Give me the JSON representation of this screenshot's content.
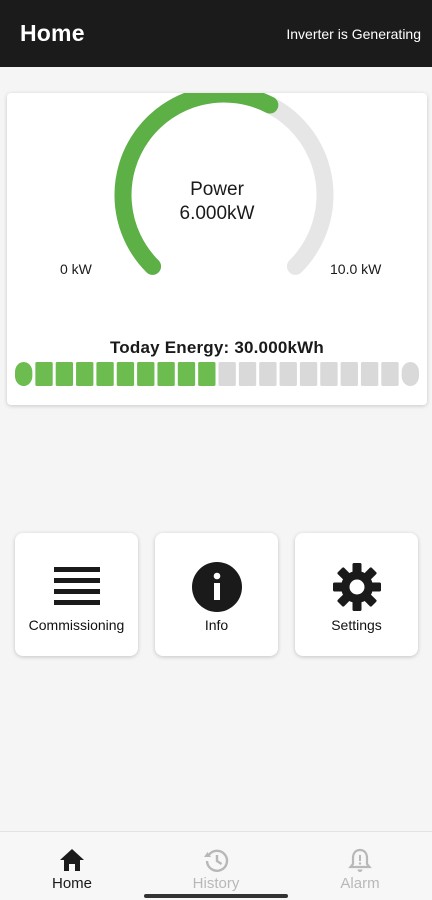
{
  "appbar": {
    "title": "Home",
    "status": "Inverter is Generating"
  },
  "gauge": {
    "label": "Power",
    "value": "6.000kW",
    "min_label": "0 kW",
    "max_label": "10.0 kW",
    "fraction": 0.6,
    "fill_color": "#5cb046",
    "track_color": "#e6e6e6"
  },
  "energy": {
    "label": "Today Energy: 30.000kWh",
    "segments_total": 20,
    "segments_filled": 10,
    "fill_color": "#6cbc4f",
    "empty_color": "#d9d9d9"
  },
  "tiles": [
    {
      "label": "Commissioning",
      "icon": "menu-icon"
    },
    {
      "label": "Info",
      "icon": "info-icon"
    },
    {
      "label": "Settings",
      "icon": "gear-icon"
    }
  ],
  "nav": [
    {
      "label": "Home",
      "icon": "home-icon",
      "active": true
    },
    {
      "label": "History",
      "icon": "history-icon",
      "active": false
    },
    {
      "label": "Alarm",
      "icon": "bell-icon",
      "active": false
    }
  ]
}
